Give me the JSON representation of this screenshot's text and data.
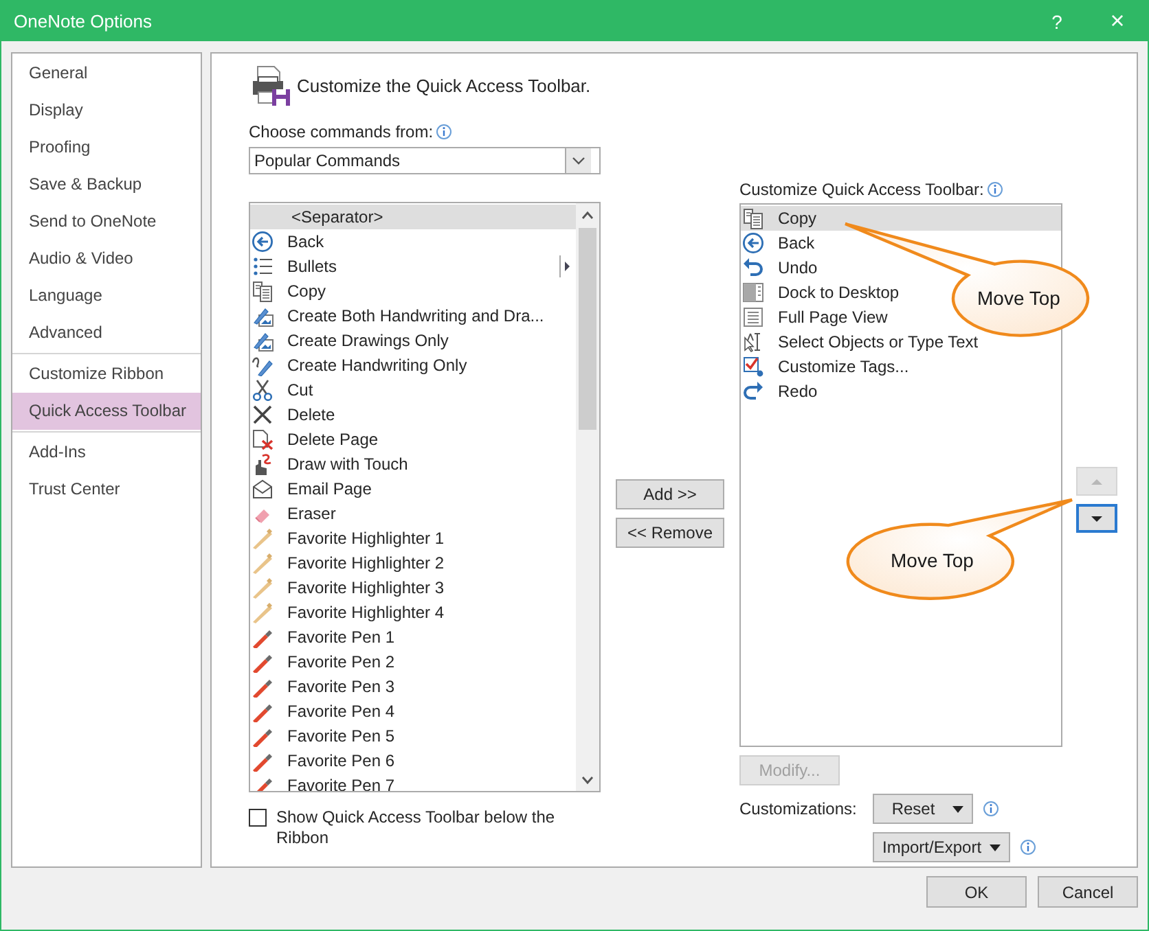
{
  "window": {
    "title": "OneNote Options",
    "help": "?",
    "close": "×"
  },
  "sidebar": {
    "sections": [
      {
        "items": [
          {
            "label": "General",
            "selected": false
          },
          {
            "label": "Display",
            "selected": false
          },
          {
            "label": "Proofing",
            "selected": false
          },
          {
            "label": "Save & Backup",
            "selected": false
          },
          {
            "label": "Send to OneNote",
            "selected": false
          },
          {
            "label": "Audio & Video",
            "selected": false
          },
          {
            "label": "Language",
            "selected": false
          },
          {
            "label": "Advanced",
            "selected": false
          }
        ]
      },
      {
        "items": [
          {
            "label": "Customize Ribbon",
            "selected": false
          },
          {
            "label": "Quick Access Toolbar",
            "selected": true
          }
        ]
      },
      {
        "items": [
          {
            "label": "Add-Ins",
            "selected": false
          },
          {
            "label": "Trust Center",
            "selected": false
          }
        ]
      }
    ]
  },
  "page": {
    "heading": "Customize the Quick Access Toolbar."
  },
  "commands": {
    "label": "Choose commands from:",
    "dropdown": {
      "value": "Popular Commands"
    },
    "items": [
      {
        "kind": "separator",
        "label": "<Separator>",
        "selected": true,
        "submenu": false
      },
      {
        "kind": "command",
        "label": "Back",
        "selected": false,
        "submenu": false
      },
      {
        "kind": "command",
        "label": "Bullets",
        "selected": false,
        "submenu": true
      },
      {
        "kind": "command",
        "label": "Copy",
        "selected": false,
        "submenu": false
      },
      {
        "kind": "command",
        "label": "Create Both Handwriting and Dra...",
        "selected": false,
        "submenu": false
      },
      {
        "kind": "command",
        "label": "Create Drawings Only",
        "selected": false,
        "submenu": false
      },
      {
        "kind": "command",
        "label": "Create Handwriting Only",
        "selected": false,
        "submenu": false
      },
      {
        "kind": "command",
        "label": "Cut",
        "selected": false,
        "submenu": false
      },
      {
        "kind": "command",
        "label": "Delete",
        "selected": false,
        "submenu": false
      },
      {
        "kind": "command",
        "label": "Delete Page",
        "selected": false,
        "submenu": false
      },
      {
        "kind": "command",
        "label": "Draw with Touch",
        "selected": false,
        "submenu": false
      },
      {
        "kind": "command",
        "label": "Email Page",
        "selected": false,
        "submenu": false
      },
      {
        "kind": "command",
        "label": "Eraser",
        "selected": false,
        "submenu": false
      },
      {
        "kind": "command",
        "label": "Favorite Highlighter 1",
        "selected": false,
        "submenu": false
      },
      {
        "kind": "command",
        "label": "Favorite Highlighter 2",
        "selected": false,
        "submenu": false
      },
      {
        "kind": "command",
        "label": "Favorite Highlighter 3",
        "selected": false,
        "submenu": false
      },
      {
        "kind": "command",
        "label": "Favorite Highlighter 4",
        "selected": false,
        "submenu": false
      },
      {
        "kind": "command",
        "label": "Favorite Pen 1",
        "selected": false,
        "submenu": false
      },
      {
        "kind": "command",
        "label": "Favorite Pen 2",
        "selected": false,
        "submenu": false
      },
      {
        "kind": "command",
        "label": "Favorite Pen 3",
        "selected": false,
        "submenu": false
      },
      {
        "kind": "command",
        "label": "Favorite Pen 4",
        "selected": false,
        "submenu": false
      },
      {
        "kind": "command",
        "label": "Favorite Pen 5",
        "selected": false,
        "submenu": false
      },
      {
        "kind": "command",
        "label": "Favorite Pen 6",
        "selected": false,
        "submenu": false
      },
      {
        "kind": "command",
        "label": "Favorite Pen 7",
        "selected": false,
        "submenu": false
      }
    ]
  },
  "add_button": {
    "label": "Add >>"
  },
  "remove_button": {
    "label": "<< Remove"
  },
  "toolbar": {
    "label": "Customize Quick Access Toolbar:",
    "items": [
      {
        "kind": "command",
        "label": "Copy",
        "selected": true,
        "submenu": false
      },
      {
        "kind": "command",
        "label": "Back",
        "selected": false,
        "submenu": false
      },
      {
        "kind": "command",
        "label": "Undo",
        "selected": false,
        "submenu": false
      },
      {
        "kind": "command",
        "label": "Dock to Desktop",
        "selected": false,
        "submenu": false
      },
      {
        "kind": "command",
        "label": "Full Page View",
        "selected": false,
        "submenu": false
      },
      {
        "kind": "command",
        "label": "Select Objects or Type Text",
        "selected": false,
        "submenu": false
      },
      {
        "kind": "command",
        "label": "Customize Tags...",
        "selected": false,
        "submenu": false
      },
      {
        "kind": "command",
        "label": "Redo",
        "selected": false,
        "submenu": false
      }
    ]
  },
  "move_buttons": [
    {
      "kind": "up",
      "disabled": true,
      "focused": false
    },
    {
      "kind": "down",
      "disabled": false,
      "focused": true
    }
  ],
  "modify_button": {
    "label": "Modify...",
    "disabled": true
  },
  "customizations": {
    "label": "Customizations:",
    "reset": "Reset",
    "import_export": "Import/Export"
  },
  "show_below_ribbon": {
    "label": "Show Quick Access Toolbar below the Ribbon",
    "checked": false
  },
  "callouts": [
    {
      "text": "Move Top"
    },
    {
      "text": "Move Top"
    }
  ],
  "buttons": [
    {
      "label": "OK"
    },
    {
      "label": "Cancel"
    }
  ]
}
